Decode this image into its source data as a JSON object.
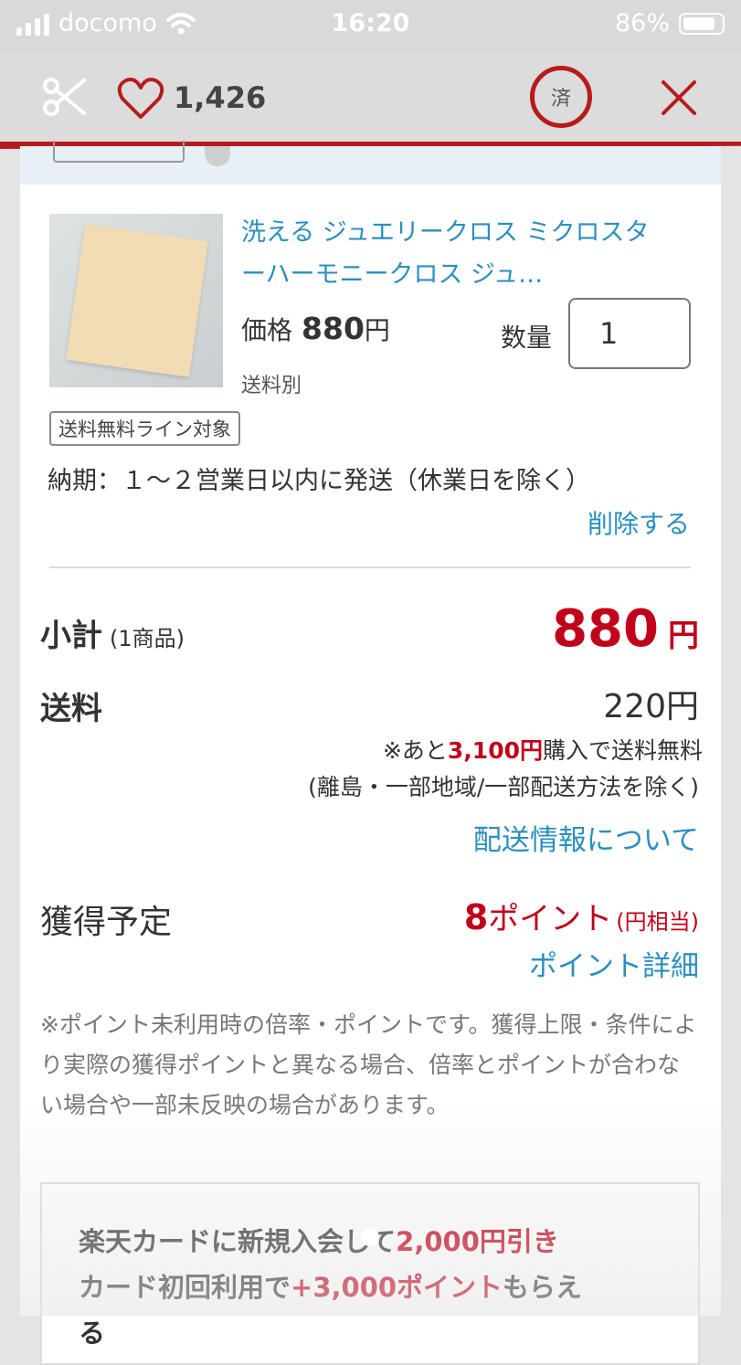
{
  "status_bar": {
    "carrier": "docomo",
    "time": "16:20",
    "battery": "86%"
  },
  "top_bar": {
    "like_count": "1,426",
    "done_label": "済"
  },
  "item": {
    "title": "洗える ジュエリークロス ミクロスターハーモニークロス ジュ…",
    "price_label": "価格",
    "price_amount": "880",
    "price_unit": "円",
    "shipping_separate": "送料別",
    "quantity_label": "数量",
    "quantity_value": "1",
    "free_line_tag": "送料無料ライン対象",
    "delivery": "納期：１～２営業日以内に発送（休業日を除く）",
    "delete_label": "削除する"
  },
  "summary": {
    "subtotal_label": "小計",
    "subtotal_count": "(1商品)",
    "subtotal_value": "880",
    "subtotal_unit": "円",
    "shipping_label": "送料",
    "shipping_value": "220円",
    "shipping_note_prefix": "※あと",
    "shipping_note_amount": "3,100円",
    "shipping_note_suffix": "購入で送料無料",
    "shipping_note_exclusion": "(離島・一部地域/一部配送方法を除く)",
    "shipping_info_link": "配送情報について",
    "points_label": "獲得予定",
    "points_value": "8",
    "points_unit": "ポイント",
    "points_equiv": "(円相当)",
    "points_detail_link": "ポイント詳細",
    "points_note": "※ポイント未利用時の倍率・ポイントです。獲得上限・条件により実際の獲得ポイントと異なる場合、倍率とポイントが合わない場合や一部未反映の場合があります。"
  },
  "card_promo": {
    "line1_prefix": "楽天カードに新規入会して",
    "line1_highlight": "2,000円引き",
    "line2_prefix": "カード初回利用で",
    "line2_highlight": "+3,000ポイント",
    "line2_suffix": "もらえ",
    "line3": "る"
  },
  "colors": {
    "accent_red": "#c0021a",
    "link_blue": "#2a8fc1",
    "bar_red": "#b71c1c"
  },
  "icons": [
    "scissors-icon",
    "heart-icon",
    "close-icon",
    "wifi-icon",
    "signal-icon",
    "battery-icon"
  ]
}
